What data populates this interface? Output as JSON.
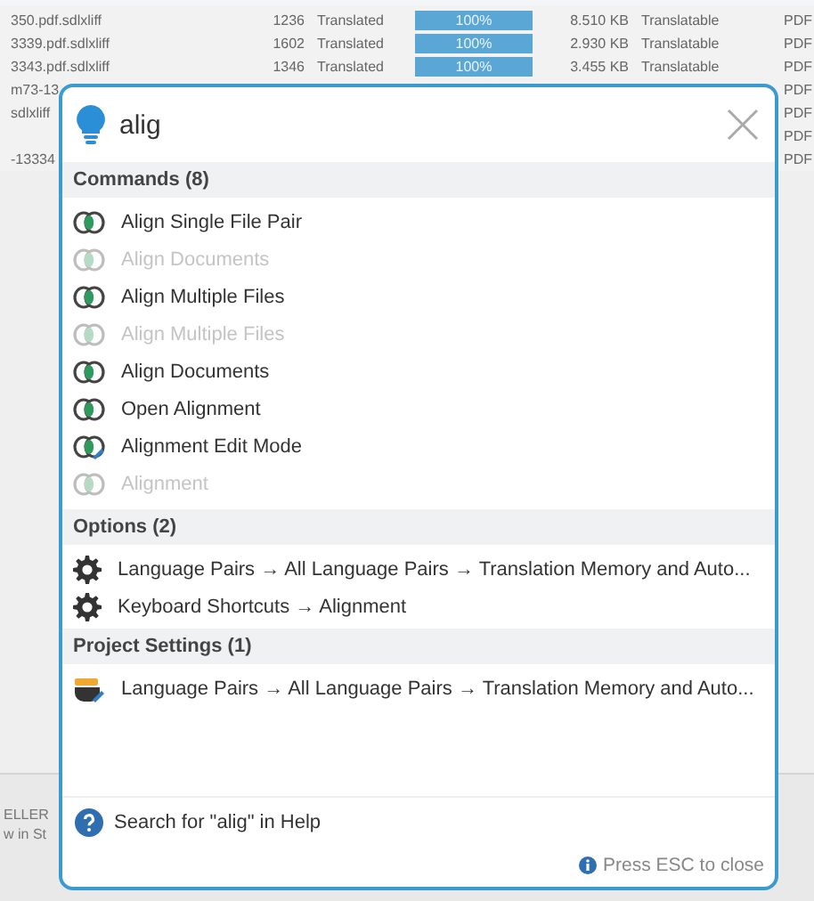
{
  "background_table": {
    "rows": [
      {
        "file": "350.pdf.sdlxliff",
        "words": "1236",
        "status": "Translated",
        "progress": "100%",
        "level": 1,
        "size": "8.510 KB",
        "type": "Translatable",
        "format": "PDF"
      },
      {
        "file": "3339.pdf.sdlxliff",
        "words": "1602",
        "status": "Translated",
        "progress": "100%",
        "level": 1,
        "size": "2.930 KB",
        "type": "Translatable",
        "format": "PDF"
      },
      {
        "file": "3343.pdf.sdlxliff",
        "words": "1346",
        "status": "Translated",
        "progress": "100%",
        "level": 1,
        "size": "3.455 KB",
        "type": "Translatable",
        "format": "PDF"
      },
      {
        "file": "m73-13",
        "format": "PDF"
      },
      {
        "file": "sdlxliff",
        "format": "PDF"
      },
      {
        "format": "PDF"
      },
      {
        "file": "-13334",
        "format": "PDF"
      }
    ],
    "bottom_labels": [
      "ELLER",
      "w in St"
    ]
  },
  "palette": {
    "search": {
      "value": "alig"
    },
    "sections": [
      {
        "title": "Commands (8)",
        "kind": "command",
        "items": [
          {
            "label": "Align Single File Pair",
            "disabled": false
          },
          {
            "label": "Align Documents",
            "disabled": true
          },
          {
            "label": "Align Multiple Files",
            "disabled": false
          },
          {
            "label": "Align Multiple Files",
            "disabled": true
          },
          {
            "label": "Align Documents",
            "disabled": false
          },
          {
            "label": "Open Alignment",
            "disabled": false
          },
          {
            "label": "Alignment Edit Mode",
            "disabled": false,
            "kind": "edit"
          },
          {
            "label": "Alignment",
            "disabled": true
          }
        ]
      },
      {
        "title": "Options (2)",
        "kind": "option",
        "items": [
          {
            "label": "Language Pairs → All Language Pairs → Translation Memory and Auto...",
            "disabled": false
          },
          {
            "label": "Keyboard Shortcuts → Alignment",
            "disabled": false
          }
        ]
      },
      {
        "title": "Project Settings (1)",
        "kind": "project",
        "items": [
          {
            "label": "Language Pairs → All Language Pairs → Translation Memory and Auto...",
            "disabled": false
          }
        ]
      }
    ],
    "help_link": "Search for \"alig\" in Help",
    "hint": "Press ESC to close"
  }
}
